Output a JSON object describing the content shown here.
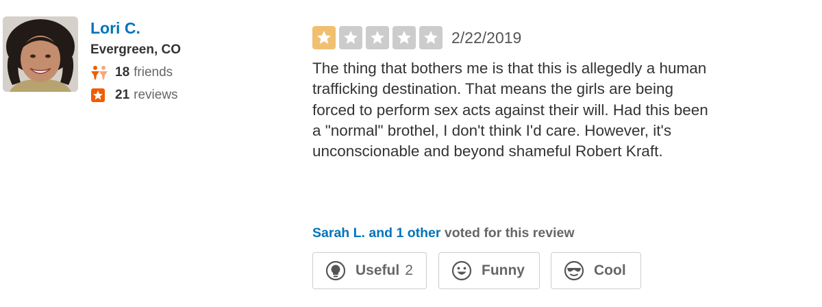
{
  "user": {
    "name": "Lori C.",
    "location": "Evergreen, CO",
    "friends_count": "18",
    "friends_label": "friends",
    "reviews_count": "21",
    "reviews_label": "reviews"
  },
  "review": {
    "rating": 1,
    "max_rating": 5,
    "date": "2/22/2019",
    "text": "The thing that bothers me is that this is allegedly a human\ntrafficking destination.  That means the girls are being\nforced to perform sex acts against their will.  Had this been\na \"normal\" brothel, I don't think I'd care.  However, it's\nunconscionable and beyond shameful Robert Kraft."
  },
  "votes": {
    "voters": "Sarah L. and 1 other",
    "suffix": "voted for this review"
  },
  "buttons": {
    "useful_label": "Useful",
    "useful_count": "2",
    "funny_label": "Funny",
    "cool_label": "Cool"
  },
  "colors": {
    "link": "#0073bb",
    "star_filled": "#f0c070",
    "star_empty": "#cccccc",
    "badge": "#f15c00"
  },
  "icons": [
    "friends-icon",
    "review-star-icon",
    "lightbulb-icon",
    "smile-icon",
    "sunglasses-icon"
  ]
}
